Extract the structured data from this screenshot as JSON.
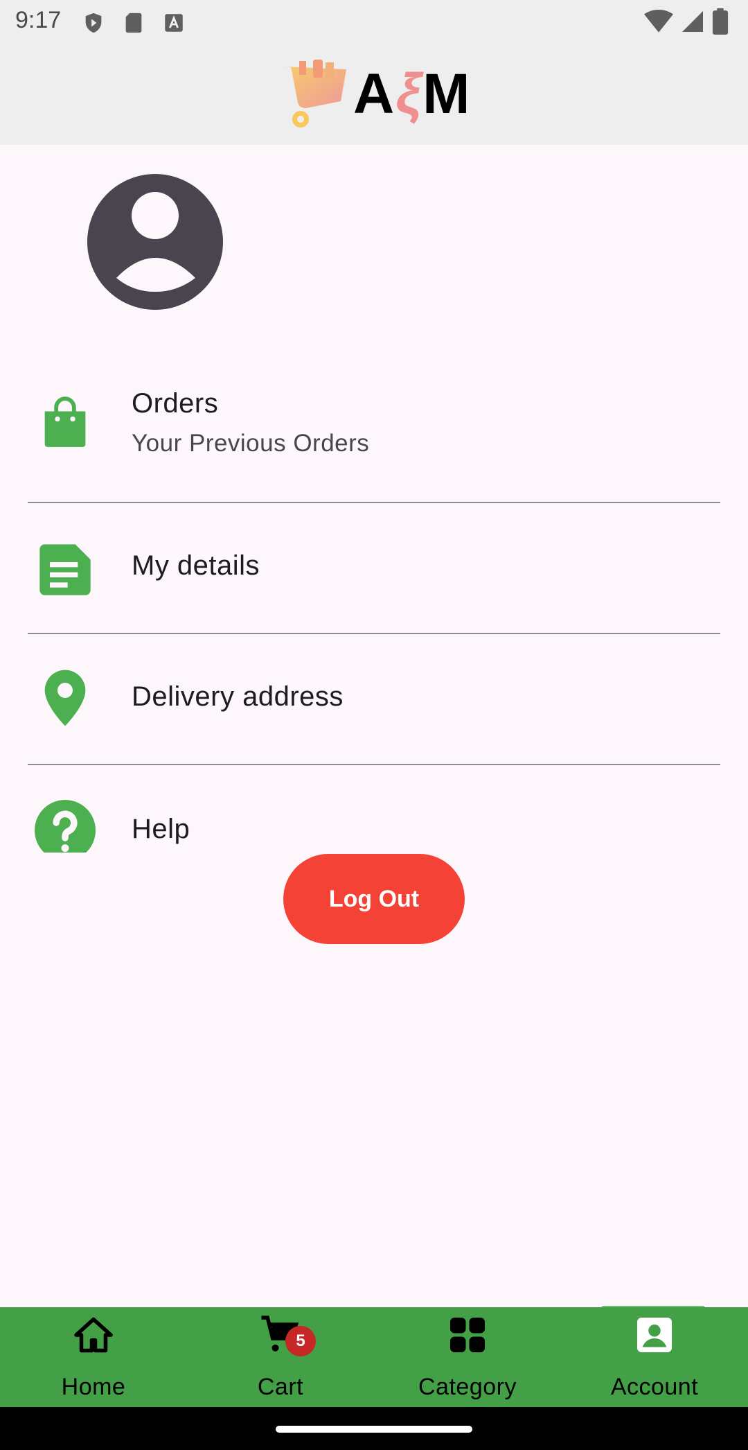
{
  "status_bar": {
    "time": "9:17"
  },
  "header": {
    "logo_parts": [
      "A",
      "ξ",
      "M"
    ]
  },
  "menu": {
    "orders": {
      "title": "Orders",
      "subtitle": "Your Previous Orders",
      "icon": "shopping-bag-icon"
    },
    "details": {
      "title": "My details",
      "icon": "document-icon"
    },
    "address": {
      "title": "Delivery address",
      "icon": "location-pin-icon"
    },
    "help": {
      "title": "Help",
      "icon": "help-icon"
    }
  },
  "logout_label": "Log Out",
  "bottom_nav": {
    "items": [
      {
        "label": "Home",
        "icon": "home-icon"
      },
      {
        "label": "Cart",
        "icon": "cart-icon"
      },
      {
        "label": "Category",
        "icon": "category-grid-icon"
      },
      {
        "label": "Account",
        "icon": "account-icon"
      }
    ],
    "cart_badge": "5",
    "active": "Account"
  },
  "colors": {
    "accent_green": "#43a047",
    "icon_green": "#4caf50",
    "logout_red": "#f44336",
    "background": "#fdf6fb",
    "avatar": "#49454f"
  }
}
